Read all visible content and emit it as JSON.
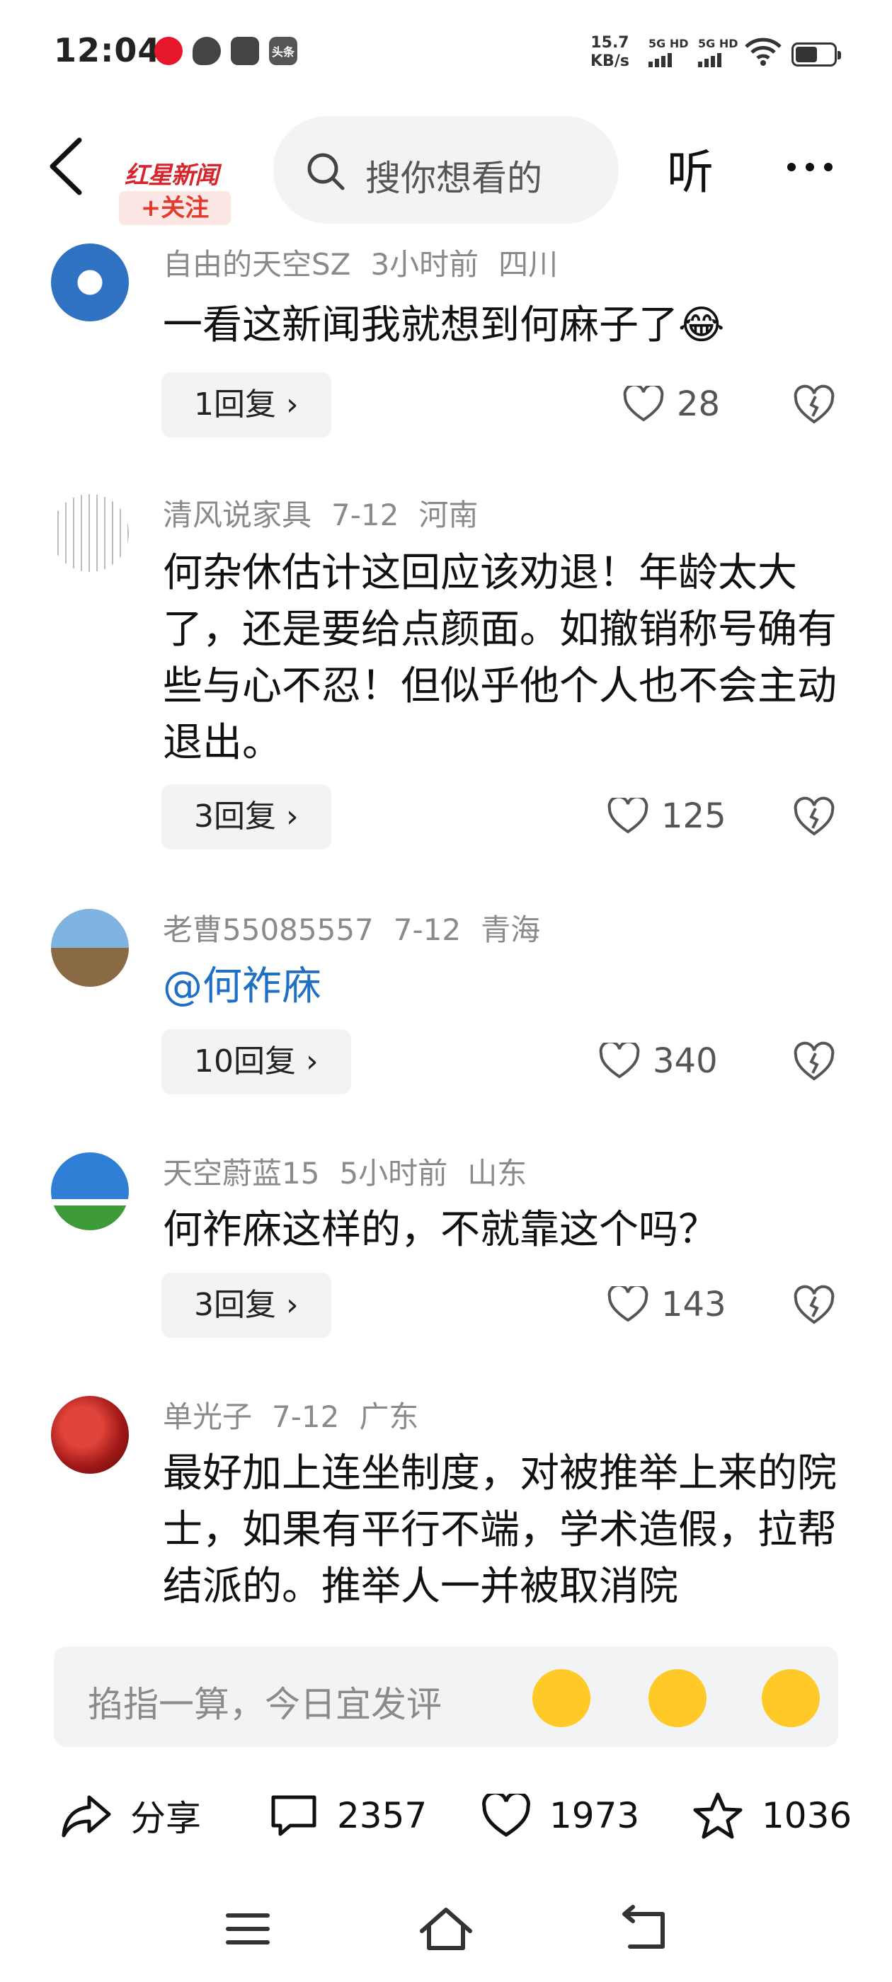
{
  "status_bar": {
    "time": "12:04",
    "speed_value": "15.7",
    "speed_unit": "KB/s",
    "sim1": "5G HD",
    "sim2": "5G HD",
    "app_tt": "头条"
  },
  "header": {
    "logo_text": "红星新闻",
    "follow_label": "+关注",
    "search_placeholder": "搜你想看的",
    "listen_label": "听"
  },
  "comments": [
    {
      "user": "自由的天空SZ",
      "time": "3小时前",
      "location": "四川",
      "text": "一看这新闻我就想到何麻子了😂",
      "replies": "1回复 ›",
      "likes": "28"
    },
    {
      "user": "清风说家具",
      "time": "7-12",
      "location": "河南",
      "text": "何杂休估计这回应该劝退！年龄太大了，还是要给点颜面。如撤销称号确有些与心不忍！但似乎他个人也不会主动退出。",
      "replies": "3回复 ›",
      "likes": "125"
    },
    {
      "user": "老曹55085557",
      "time": "7-12",
      "location": "青海",
      "text": "@何祚庥",
      "replies": "10回复 ›",
      "likes": "340"
    },
    {
      "user": "天空蔚蓝15",
      "time": "5小时前",
      "location": "山东",
      "text": "何祚庥这样的，不就靠这个吗？",
      "replies": "3回复 ›",
      "likes": "143"
    },
    {
      "user": "单光子",
      "time": "7-12",
      "location": "广东",
      "text": "最好加上连坐制度，对被推举上来的院士，如果有平行不端，学术造假，拉帮结派的。推举人一并被取消院"
    }
  ],
  "input": {
    "placeholder": "掐指一算，今日宜发评"
  },
  "actions": {
    "share": "分享",
    "comments": "2357",
    "likes": "1973",
    "favorites": "1036"
  },
  "colors": {
    "brand_red": "#d8242c",
    "mention_blue": "#1f6fc7",
    "muted_gray": "#8a8a8a"
  }
}
